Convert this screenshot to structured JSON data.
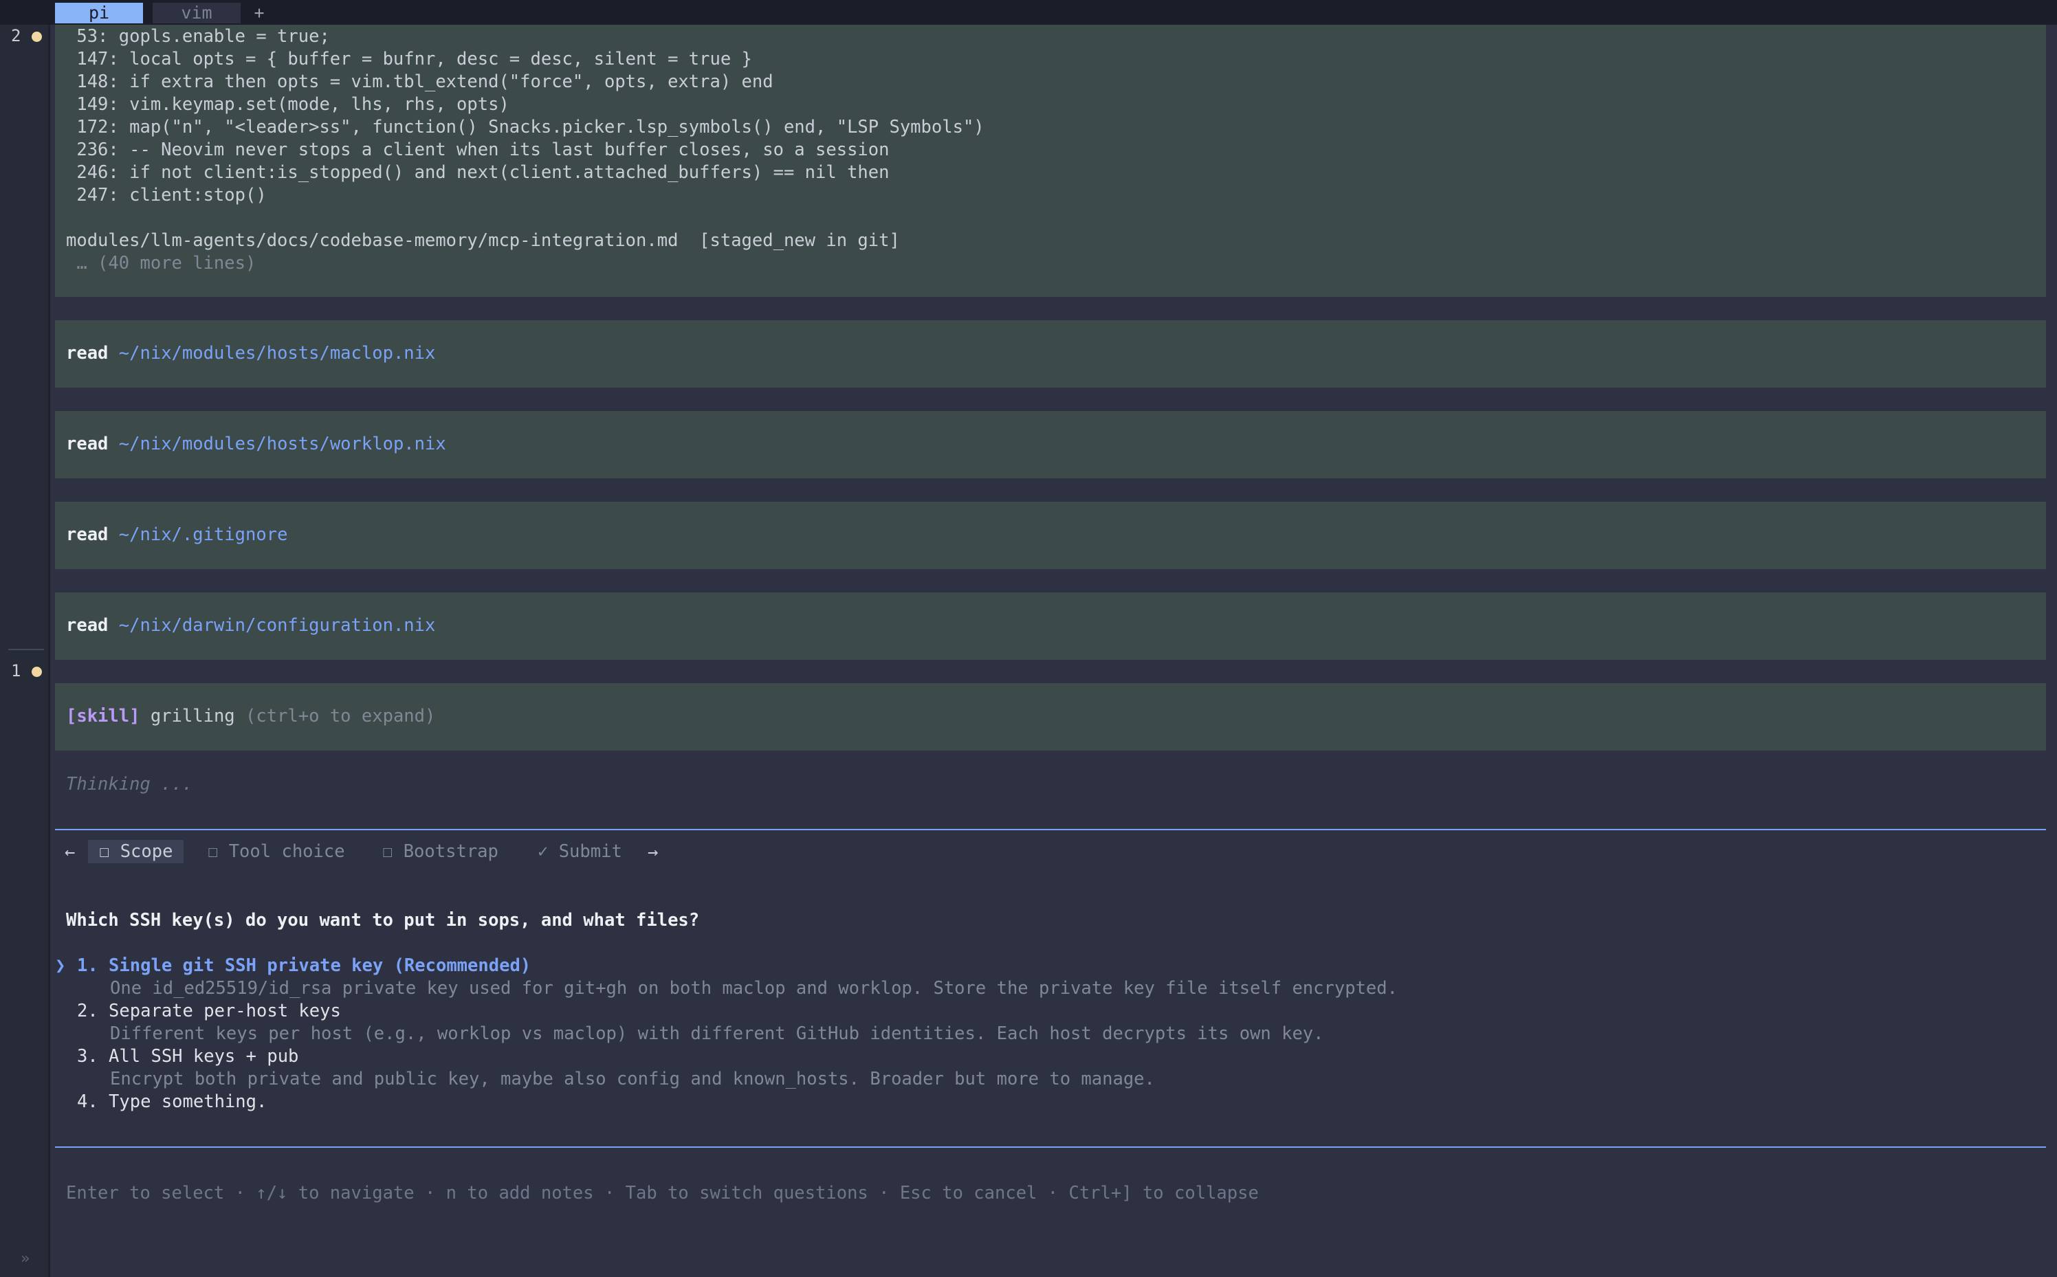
{
  "tabs": {
    "active": "pi",
    "inactive": "vim",
    "add": "+"
  },
  "gutter": {
    "row1_num": "1",
    "row1_tick": "·",
    "row2_num": "2",
    "row3_num": "1",
    "chevron": "»"
  },
  "result_block": {
    "lines": [
      " 53: gopls.enable = true;",
      " 147: local opts = { buffer = bufnr, desc = desc, silent = true }",
      " 148: if extra then opts = vim.tbl_extend(\"force\", opts, extra) end",
      " 149: vim.keymap.set(mode, lhs, rhs, opts)",
      " 172: map(\"n\", \"<leader>ss\", function() Snacks.picker.lsp_symbols() end, \"LSP Symbols\")",
      " 236: -- Neovim never stops a client when its last buffer closes, so a session",
      " 246: if not client:is_stopped() and next(client.attached_buffers) == nil then",
      " 247: client:stop()"
    ],
    "file_line": "modules/llm-agents/docs/codebase-memory/mcp-integration.md  [staged_new in git]",
    "more_line": " … (40 more lines)"
  },
  "reads": [
    {
      "verb": "read",
      "path": "~/nix/modules/hosts/maclop.nix"
    },
    {
      "verb": "read",
      "path": "~/nix/modules/hosts/worklop.nix"
    },
    {
      "verb": "read",
      "path": "~/nix/.gitignore"
    },
    {
      "verb": "read",
      "path": "~/nix/darwin/configuration.nix"
    }
  ],
  "skill": {
    "tag": "[skill]",
    "name": "grilling",
    "hint": "(ctrl+o to expand)"
  },
  "thinking": "Thinking ...",
  "question_tabs": {
    "left_arrow": "←",
    "right_arrow": "→",
    "items": [
      {
        "label": "☐ Scope"
      },
      {
        "label": "☐ Tool choice"
      },
      {
        "label": "☐ Bootstrap"
      },
      {
        "label": "✓ Submit"
      }
    ]
  },
  "question": "Which SSH key(s) do you want to put in sops, and what files?",
  "options": [
    {
      "label": "1. Single git SSH private key (Recommended)",
      "desc": "One id_ed25519/id_rsa private key used for git+gh on both maclop and worklop. Store the private key file itself encrypted."
    },
    {
      "label": "2. Separate per-host keys",
      "desc": "Different keys per host (e.g., worklop vs maclop) with different GitHub identities. Each host decrypts its own key."
    },
    {
      "label": "3. All SSH keys + pub",
      "desc": "Encrypt both private and public key, maybe also config and known_hosts. Broader but more to manage."
    },
    {
      "label": "4. Type something.",
      "desc": ""
    }
  ],
  "cursor": "❯",
  "help": "Enter to select · ↑/↓ to navigate · n to add notes · Tab to switch questions · Esc to cancel · Ctrl+] to collapse"
}
